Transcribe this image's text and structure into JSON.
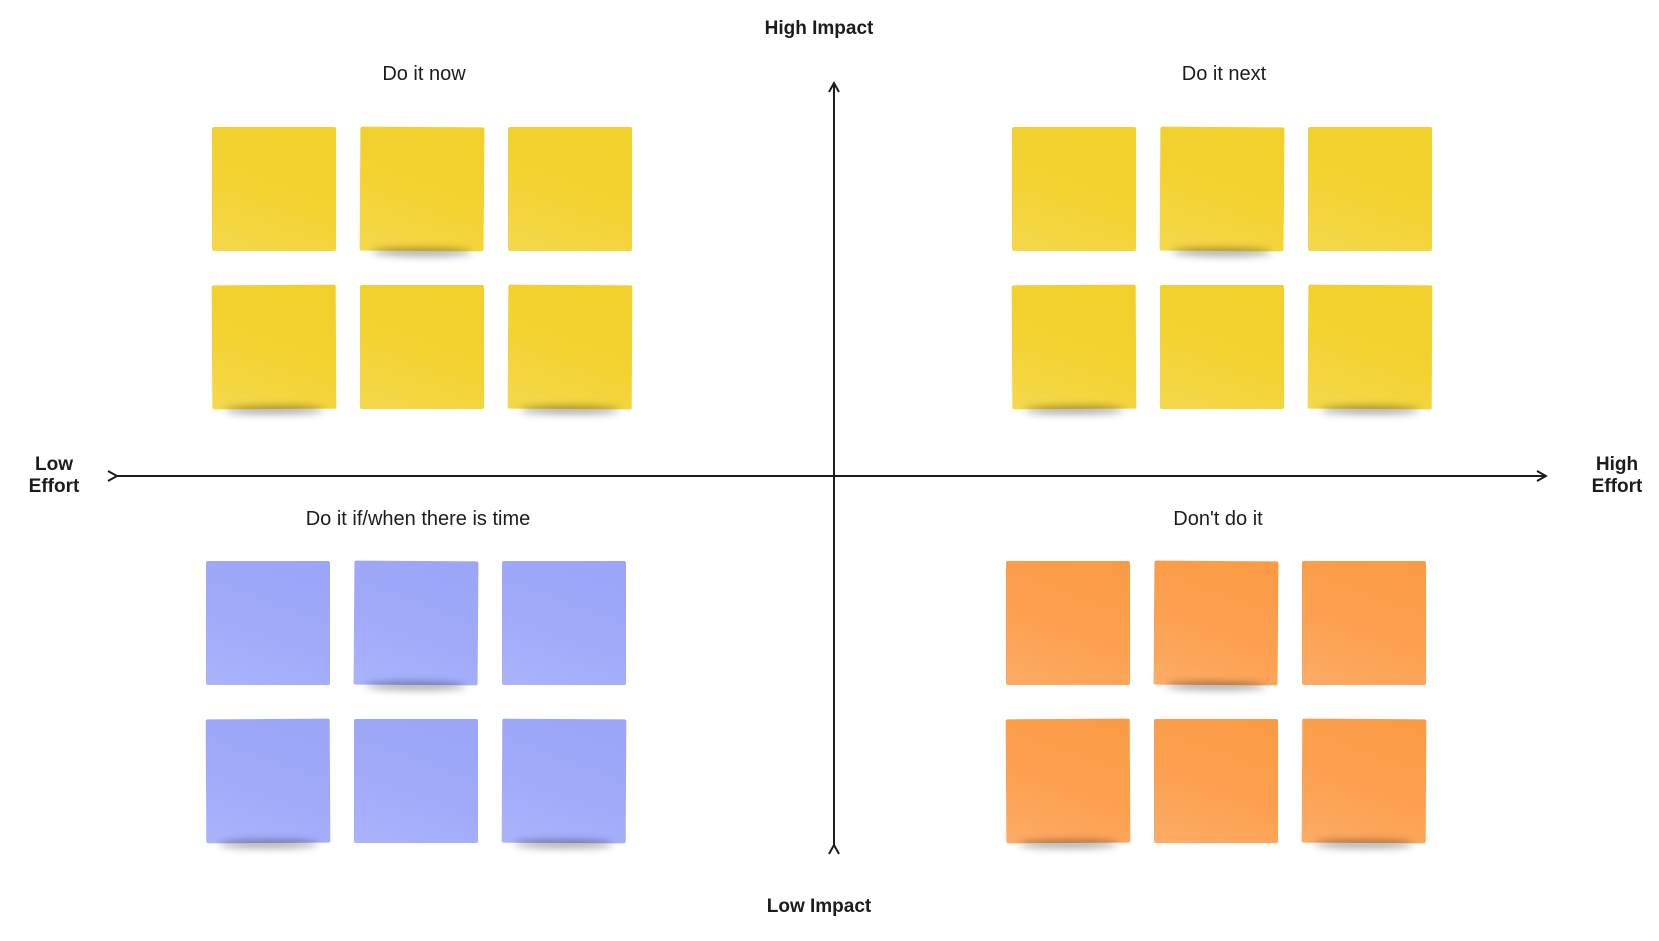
{
  "axes": {
    "vertical": {
      "top_label": "High Impact",
      "bottom_label": "Low Impact"
    },
    "horizontal": {
      "left_label": "Low Effort",
      "right_label": "High Effort"
    }
  },
  "quadrants": [
    {
      "title": "Do it now",
      "note_color": "#f3d232",
      "note_count": 6
    },
    {
      "title": "Do it next",
      "note_color": "#f3d232",
      "note_count": 6
    },
    {
      "title": "Do it if/when there is time",
      "note_color": "#a0aaf9",
      "note_count": 6
    },
    {
      "title": "Don't do it",
      "note_color": "#fca050",
      "note_count": 6
    }
  ],
  "colors": {
    "axis_line": "#1c1c1e",
    "background": "#ffffff",
    "yellow_note": "#f3d232",
    "blue_note": "#a0aaf9",
    "orange_note": "#fca050"
  }
}
